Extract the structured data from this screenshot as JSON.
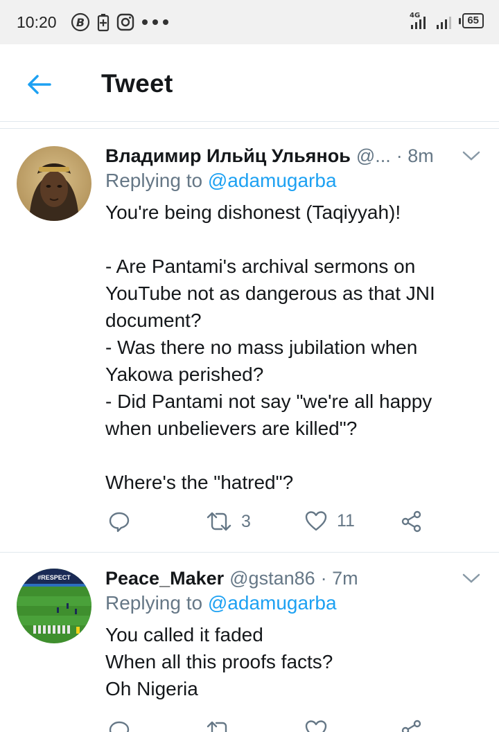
{
  "status_bar": {
    "time": "10:20",
    "network": "4G",
    "battery": "65"
  },
  "header": {
    "title": "Tweet"
  },
  "tweets": [
    {
      "name": "Владимир Ильйц Ульяноь",
      "handle": "@...",
      "time": "· 8m",
      "replying_prefix": "Replying to ",
      "replying_to": "@adamugarba",
      "lines": [
        "You're being dishonest (Taqiyyah)!",
        "",
        "- Are Pantami's archival sermons on",
        "YouTube not as dangerous as that JNI",
        "document?",
        "- Was there no mass jubilation when",
        "Yakowa perished?",
        "- Did Pantami not say \"we're all happy",
        "when unbelievers are killed\"?",
        "",
        "Where's the \"hatred\"?"
      ],
      "retweets": "3",
      "likes": "11"
    },
    {
      "name": "Peace_Maker",
      "handle": "@gstan86",
      "time": "· 7m",
      "replying_prefix": "Replying to ",
      "replying_to": "@adamugarba",
      "lines": [
        "You called it faded",
        "When all this proofs facts?",
        "Oh Nigeria"
      ],
      "avatar_banner": "#RESPECT"
    }
  ],
  "colors": {
    "accent": "#1da1f2",
    "secondary_text": "#657786",
    "divider": "#e1e8ed"
  },
  "icons": [
    "back-arrow-icon",
    "reply-icon",
    "retweet-icon",
    "like-icon",
    "share-icon",
    "chevron-down-icon"
  ]
}
